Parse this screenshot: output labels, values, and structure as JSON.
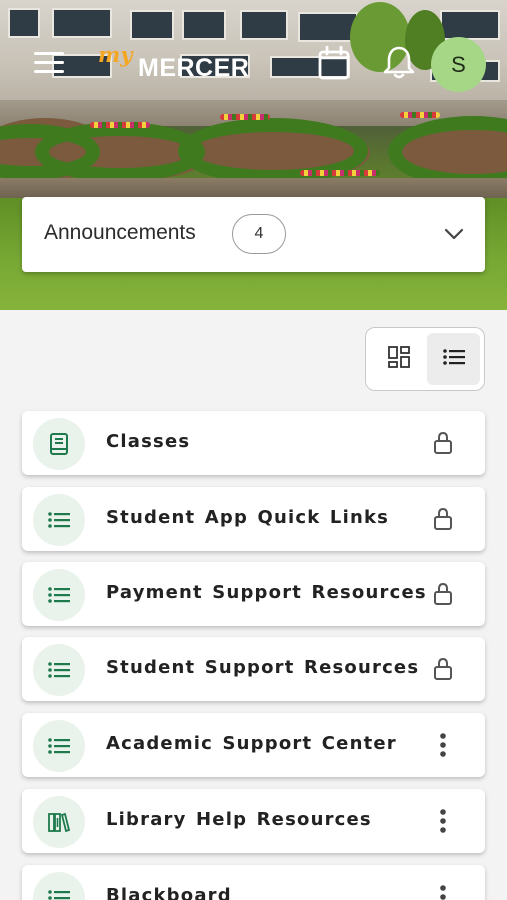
{
  "header": {
    "logo_prefix": "my",
    "logo_text": "MERCER",
    "avatar_initial": "S"
  },
  "announcements": {
    "label": "Announcements",
    "count": "4"
  },
  "view_toggle": {
    "options": [
      "grid-view",
      "list-view"
    ],
    "selected": "list-view"
  },
  "colors": {
    "accent_green": "#1e7a4c",
    "icon_bg": "#e9f3ec",
    "avatar_bg": "#a6d787",
    "logo_orange": "#f5a623"
  },
  "items": [
    {
      "label": "Classes",
      "icon": "book-icon",
      "action": "lock-icon"
    },
    {
      "label": "Student App Quick Links",
      "icon": "list-icon",
      "action": "lock-icon"
    },
    {
      "label": "Payment Support Resources",
      "icon": "list-icon",
      "action": "lock-icon"
    },
    {
      "label": "Student Support Resources",
      "icon": "list-icon",
      "action": "lock-icon"
    },
    {
      "label": "Academic Support Center",
      "icon": "list-icon",
      "action": "more-vertical-icon"
    },
    {
      "label": "Library Help Resources",
      "icon": "library-books-icon",
      "action": "more-vertical-icon"
    },
    {
      "label": "Blackboard",
      "icon": "list-icon",
      "action": "more-vertical-icon"
    }
  ]
}
